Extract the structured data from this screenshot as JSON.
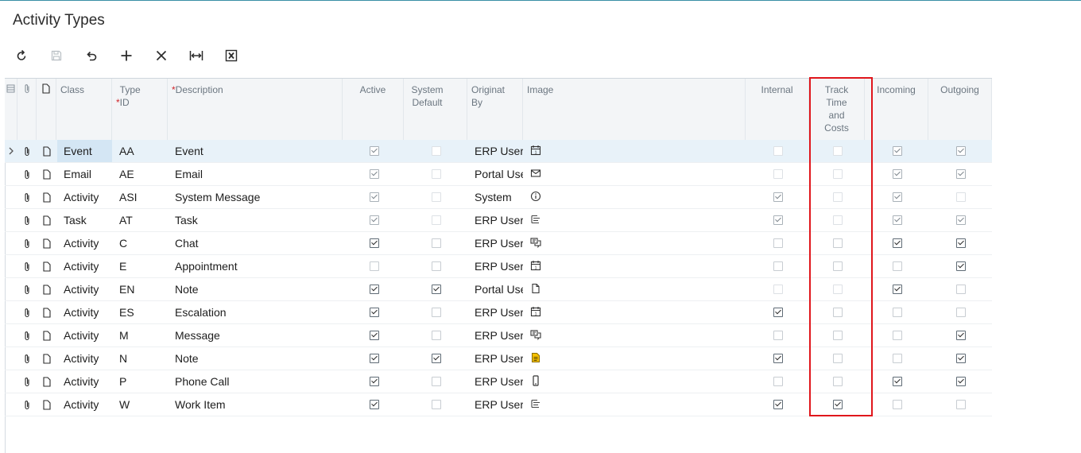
{
  "page": {
    "title": "Activity Types"
  },
  "toolbar": {
    "buttons": [
      {
        "name": "refresh-button",
        "icon": "refresh-icon"
      },
      {
        "name": "save-button",
        "icon": "save-icon"
      },
      {
        "name": "undo-button",
        "icon": "undo-icon"
      },
      {
        "name": "add-row-button",
        "icon": "plus-icon"
      },
      {
        "name": "delete-row-button",
        "icon": "close-icon"
      },
      {
        "name": "fit-to-screen-button",
        "icon": "fit-width-icon"
      },
      {
        "name": "export-excel-button",
        "icon": "excel-icon"
      }
    ]
  },
  "grid": {
    "columns": {
      "class": "Class",
      "type_id_req": "*",
      "type_id": "Type ID",
      "description_req": "*",
      "description": "Description",
      "active": "Active",
      "system_default": "System Default",
      "originated_by": "Originat By",
      "image": "Image",
      "internal": "Internal",
      "track_time": "Track Time and Costs",
      "incoming": "Incoming",
      "outgoing": "Outgoing"
    },
    "rows": [
      {
        "class": "Event",
        "type_id": "AA",
        "description": "Event",
        "active": true,
        "system_default": false,
        "originated_by": "ERP Users",
        "image": "calendar-icon",
        "internal": false,
        "track_time": false,
        "incoming": true,
        "outgoing": true,
        "selected": true,
        "readonly": true
      },
      {
        "class": "Email",
        "type_id": "AE",
        "description": "Email",
        "active": true,
        "system_default": false,
        "originated_by": "Portal Users",
        "image": "envelope-icon",
        "internal": false,
        "track_time": false,
        "incoming": true,
        "outgoing": true,
        "readonly": true
      },
      {
        "class": "Activity",
        "type_id": "ASI",
        "description": "System Message",
        "active": true,
        "system_default": false,
        "originated_by": "System",
        "image": "info-icon",
        "internal": true,
        "track_time": false,
        "incoming": true,
        "outgoing": false,
        "readonly": true
      },
      {
        "class": "Task",
        "type_id": "AT",
        "description": "Task",
        "active": true,
        "system_default": false,
        "originated_by": "ERP Users",
        "image": "task-icon",
        "internal": true,
        "track_time": false,
        "incoming": true,
        "outgoing": true,
        "readonly": true
      },
      {
        "class": "Activity",
        "type_id": "C",
        "description": "Chat",
        "active": true,
        "system_default": false,
        "originated_by": "ERP Users",
        "image": "chat-icon",
        "internal": false,
        "track_time": false,
        "incoming": true,
        "outgoing": true
      },
      {
        "class": "Activity",
        "type_id": "E",
        "description": "Appointment",
        "active": false,
        "system_default": false,
        "originated_by": "ERP Users",
        "image": "calendar-icon",
        "internal": false,
        "track_time": false,
        "incoming": false,
        "outgoing": true
      },
      {
        "class": "Activity",
        "type_id": "EN",
        "description": "Note",
        "active": true,
        "system_default": true,
        "originated_by": "Portal Users",
        "image": "document-icon",
        "internal": false,
        "track_time": false,
        "incoming": true,
        "outgoing": false,
        "internal_dim": true,
        "track_dim": true
      },
      {
        "class": "Activity",
        "type_id": "ES",
        "description": "Escalation",
        "active": true,
        "system_default": false,
        "originated_by": "ERP Users",
        "image": "calendar-icon",
        "internal": true,
        "track_time": false,
        "incoming": false,
        "outgoing": false
      },
      {
        "class": "Activity",
        "type_id": "M",
        "description": "Message",
        "active": true,
        "system_default": false,
        "originated_by": "ERP Users",
        "image": "chat-icon",
        "internal": false,
        "track_time": false,
        "incoming": false,
        "outgoing": true
      },
      {
        "class": "Activity",
        "type_id": "N",
        "description": "Note",
        "active": true,
        "system_default": true,
        "originated_by": "ERP Users",
        "image": "note-yellow-icon",
        "internal": true,
        "track_time": false,
        "incoming": false,
        "outgoing": true
      },
      {
        "class": "Activity",
        "type_id": "P",
        "description": "Phone Call",
        "active": true,
        "system_default": false,
        "originated_by": "ERP Users",
        "image": "phone-icon",
        "internal": false,
        "track_time": false,
        "incoming": true,
        "outgoing": true
      },
      {
        "class": "Activity",
        "type_id": "W",
        "description": "Work Item",
        "active": true,
        "system_default": false,
        "originated_by": "ERP Users",
        "image": "task-icon",
        "internal": true,
        "track_time": true,
        "incoming": false,
        "outgoing": false
      }
    ]
  },
  "colors": {
    "highlight": "#e0161c",
    "selected_row": "#e8f2f9",
    "header_bg": "#f3f5f7",
    "note_icon": "#f5c000"
  }
}
